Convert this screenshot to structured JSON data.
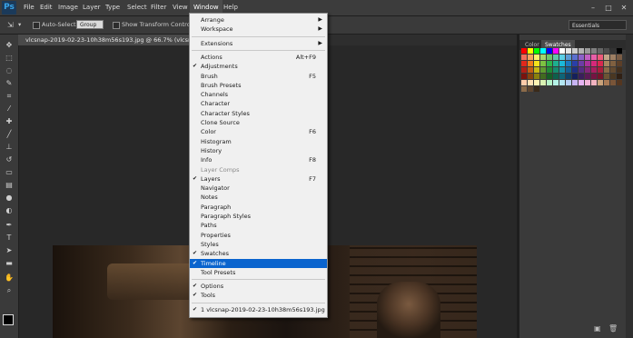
{
  "app": {
    "logo": "Ps"
  },
  "menubar": {
    "items": [
      "File",
      "Edit",
      "Image",
      "Layer",
      "Type",
      "Select",
      "Filter",
      "View",
      "Window",
      "Help"
    ],
    "active": "Window",
    "window_controls": [
      "–",
      "□",
      "✕"
    ]
  },
  "options": {
    "auto_select_label": "Auto-Select:",
    "auto_select_value": "Group",
    "show_transform_label": "Show Transform Controls",
    "workspace": "Essentials"
  },
  "document": {
    "tab_title": "vlcsnap-2019-02-23-10h38m56s193.jpg @ 66.7% (vlcsnap-2019-0"
  },
  "panels": {
    "tabs": [
      "Color",
      "Swatches"
    ],
    "active_tab": "Swatches",
    "swatch_colors": [
      "#ff0000",
      "#ffff00",
      "#00ff00",
      "#00ffff",
      "#0000ff",
      "#ff00ff",
      "#ffffff",
      "#e6e6e6",
      "#cccccc",
      "#b3b3b3",
      "#999999",
      "#808080",
      "#666666",
      "#4d4d4d",
      "#333333",
      "#000000",
      "#f26d5b",
      "#f7a55f",
      "#fdf06e",
      "#a6d46e",
      "#6ec56c",
      "#5fc6a8",
      "#5ccfe6",
      "#5b9bd5",
      "#5a6fd0",
      "#8c62c9",
      "#c160c3",
      "#e95ea8",
      "#ed5b7a",
      "#c2a689",
      "#9e7f63",
      "#7a5c45",
      "#e0281c",
      "#f27d1c",
      "#f5e31c",
      "#7dc142",
      "#2fb34a",
      "#1daf8f",
      "#1cb8d9",
      "#1b79c0",
      "#2a3fa8",
      "#6d3ca6",
      "#a8329c",
      "#d6287a",
      "#d9284f",
      "#a8875f",
      "#806040",
      "#5c3f28",
      "#b01e16",
      "#c25f14",
      "#c7b814",
      "#5f9a30",
      "#208a37",
      "#158a6f",
      "#1490ab",
      "#155f96",
      "#1e2f82",
      "#542d82",
      "#83267a",
      "#a81e5f",
      "#aa1e3d",
      "#8a6c48",
      "#634a30",
      "#44301e",
      "#7a130e",
      "#87420e",
      "#8a800e",
      "#426b20",
      "#165f26",
      "#0e5f4c",
      "#0e6477",
      "#0f4268",
      "#15205b",
      "#3a1f5b",
      "#5b1a55",
      "#751442",
      "#76142a",
      "#6c5434",
      "#4a3722",
      "#302014",
      "#ffccaa",
      "#ffe0b3",
      "#fff2b3",
      "#d9f2b3",
      "#b3f2c7",
      "#b3f2e6",
      "#b3e6f2",
      "#b3ccf2",
      "#c7b3f2",
      "#e6b3f2",
      "#f2b3d9",
      "#f2b3c0",
      "#c9a27a",
      "#a87a55",
      "#7a5538",
      "#543620",
      "#8b6b4a",
      "#5e4630",
      "#3a2a1a"
    ]
  },
  "window_menu": {
    "items": [
      {
        "label": "Arrange",
        "shortcut": "",
        "checked": false,
        "submenu": true
      },
      {
        "label": "Workspace",
        "shortcut": "",
        "checked": false,
        "submenu": true
      },
      {
        "sep": true
      },
      {
        "label": "Extensions",
        "shortcut": "",
        "checked": false,
        "submenu": true
      },
      {
        "sep": true
      },
      {
        "label": "Actions",
        "shortcut": "Alt+F9",
        "checked": false
      },
      {
        "label": "Adjustments",
        "shortcut": "",
        "checked": true
      },
      {
        "label": "Brush",
        "shortcut": "F5",
        "checked": false
      },
      {
        "label": "Brush Presets",
        "shortcut": "",
        "checked": false
      },
      {
        "label": "Channels",
        "shortcut": "",
        "checked": false
      },
      {
        "label": "Character",
        "shortcut": "",
        "checked": false
      },
      {
        "label": "Character Styles",
        "shortcut": "",
        "checked": false
      },
      {
        "label": "Clone Source",
        "shortcut": "",
        "checked": false
      },
      {
        "label": "Color",
        "shortcut": "F6",
        "checked": false
      },
      {
        "label": "Histogram",
        "shortcut": "",
        "checked": false
      },
      {
        "label": "History",
        "shortcut": "",
        "checked": false
      },
      {
        "label": "Info",
        "shortcut": "F8",
        "checked": false
      },
      {
        "label": "Layer Comps",
        "shortcut": "",
        "checked": false
      },
      {
        "label": "Layers",
        "shortcut": "F7",
        "checked": true
      },
      {
        "label": "Navigator",
        "shortcut": "",
        "checked": false
      },
      {
        "label": "Notes",
        "shortcut": "",
        "checked": false
      },
      {
        "label": "Paragraph",
        "shortcut": "",
        "checked": false
      },
      {
        "label": "Paragraph Styles",
        "shortcut": "",
        "checked": false
      },
      {
        "label": "Paths",
        "shortcut": "",
        "checked": false
      },
      {
        "label": "Properties",
        "shortcut": "",
        "checked": false
      },
      {
        "label": "Styles",
        "shortcut": "",
        "checked": false
      },
      {
        "label": "Swatches",
        "shortcut": "",
        "checked": true
      },
      {
        "label": "Timeline",
        "shortcut": "",
        "checked": true,
        "highlighted": true
      },
      {
        "label": "Tool Presets",
        "shortcut": "",
        "checked": false
      },
      {
        "sep": true
      },
      {
        "label": "Options",
        "shortcut": "",
        "checked": true
      },
      {
        "label": "Tools",
        "shortcut": "",
        "checked": true
      },
      {
        "sep": true
      },
      {
        "label": "1 vlcsnap-2019-02-23-10h38m56s193.jpg",
        "shortcut": "",
        "checked": true
      }
    ]
  },
  "icons": {
    "check": "✔",
    "submenu_arrow": "▶",
    "tools": [
      "move-tool",
      "marquee-tool",
      "lasso-tool",
      "quick-select-tool",
      "crop-tool",
      "eyedropper-tool",
      "healing-tool",
      "brush-tool",
      "clone-stamp-tool",
      "history-brush-tool",
      "eraser-tool",
      "gradient-tool",
      "blur-tool",
      "dodge-tool",
      "pen-tool",
      "type-tool",
      "path-select-tool",
      "shape-tool",
      "hand-tool",
      "zoom-tool"
    ]
  }
}
